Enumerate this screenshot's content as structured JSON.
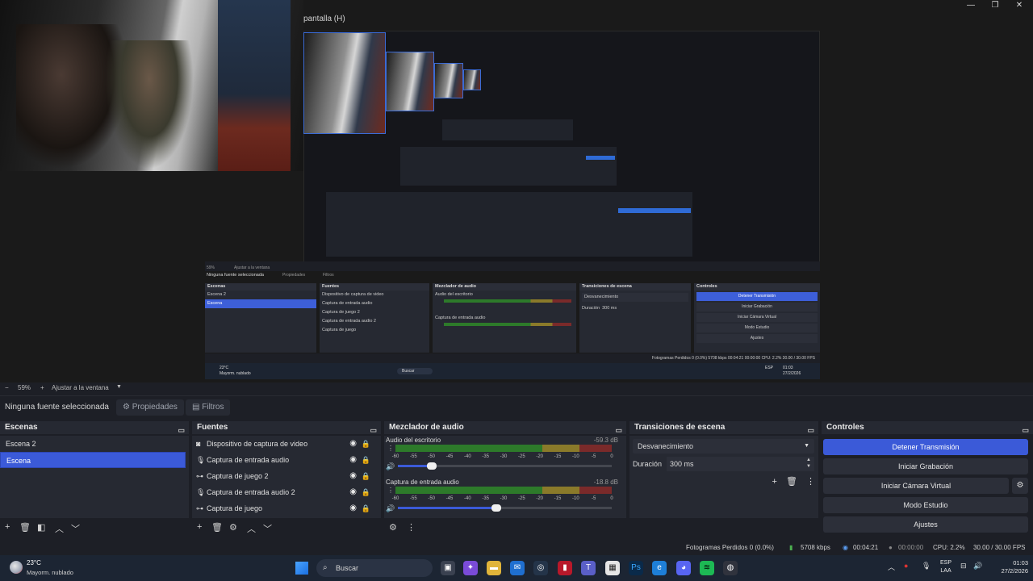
{
  "window": {
    "title": "pantalla (H)",
    "controls": [
      "—",
      "❐",
      "✕"
    ]
  },
  "preview": {
    "nested_obs": {
      "selection": "Ninguna fuente seleccionada",
      "props": "Propiedades",
      "filters": "Filtros",
      "scenes_title": "Escenas",
      "scenes": [
        "Escena 2",
        "Escena"
      ],
      "sources_title": "Fuentes",
      "sources": [
        "Dispositivo de captura de video",
        "Captura de entrada audio",
        "Captura de juego 2",
        "Captura de entrada audio 2",
        "Captura de juego"
      ],
      "mixer_title": "Mezclador de audio",
      "mixer_ch1": "Audio del escritorio",
      "mixer_ch2": "Captura de entrada audio",
      "trans_title": "Transiciones de escena",
      "trans_value": "Desvanecimiento",
      "trans_dur_label": "Duración",
      "trans_dur_value": "300 ms",
      "controls_title": "Controles",
      "controls": [
        "Detener Transmisión",
        "Iniciar Grabación",
        "Iniciar Cámara Virtual",
        "Modo Estudio",
        "Ajustes"
      ],
      "status": "Fotogramas Perdidos 0 (0.0%)   5708 kbps   00:04:21   00:00:00   CPU: 2.2%   30.00 / 30.00 FPS",
      "zoom": "59%",
      "fit": "Ajustar a la ventana",
      "weather": "23°C",
      "weather_cond": "Mayorm. nublado",
      "search": "Buscar",
      "lang": "ESP",
      "date": "27/2/2026",
      "time": "01:03"
    }
  },
  "zoom": {
    "minus": "−",
    "value": "59%",
    "plus": "+",
    "fit_label": "Ajustar a la ventana"
  },
  "context": {
    "selection": "Ninguna fuente seleccionada",
    "properties": "Propiedades",
    "filters": "Filtros"
  },
  "scenes": {
    "title": "Escenas",
    "items": [
      "Escena 2",
      "Escena"
    ],
    "selected": 1
  },
  "sources": {
    "title": "Fuentes",
    "items": [
      {
        "label": "Dispositivo de captura de video",
        "icon": "camera-icon"
      },
      {
        "label": "Captura de entrada audio",
        "icon": "mic-icon"
      },
      {
        "label": "Captura de juego 2",
        "icon": "gamepad-icon"
      },
      {
        "label": "Captura de entrada audio 2",
        "icon": "mic-icon"
      },
      {
        "label": "Captura de juego",
        "icon": "gamepad-icon"
      }
    ]
  },
  "mixer": {
    "title": "Mezclador de audio",
    "ticks": [
      "-60",
      "-55",
      "-50",
      "-45",
      "-40",
      "-35",
      "-30",
      "-25",
      "-20",
      "-15",
      "-10",
      "-5",
      "0"
    ],
    "channels": [
      {
        "name": "Audio del escritorio",
        "db": "-59.3 dB",
        "volume_pct": 16
      },
      {
        "name": "Captura de entrada audio",
        "db": "-18.8 dB",
        "volume_pct": 46
      }
    ]
  },
  "transitions": {
    "title": "Transiciones de escena",
    "selected": "Desvanecimiento",
    "duration_label": "Duración",
    "duration_value": "300 ms"
  },
  "controls": {
    "title": "Controles",
    "stop_stream": "Detener Transmisión",
    "start_recording": "Iniciar Grabación",
    "start_virtual_cam": "Iniciar Cámara Virtual",
    "studio_mode": "Modo Estudio",
    "settings": "Ajustes"
  },
  "status": {
    "dropped_frames": "Fotogramas Perdidos 0 (0.0%)",
    "bitrate": "5708 kbps",
    "stream_time": "00:04:21",
    "rec_time": "00:00:00",
    "cpu": "CPU: 2.2%",
    "fps": "30.00 / 30.00 FPS"
  },
  "taskbar": {
    "temperature": "23°C",
    "condition": "Mayorm. nublado",
    "search_placeholder": "Buscar",
    "lang_top": "ESP",
    "lang_bottom": "LAA",
    "time": "01:03",
    "date": "27/2/2026"
  },
  "colors": {
    "accent": "#3b5ad8",
    "panel": "#262932",
    "background": "#1d1f26",
    "meter_green": "#2d7a2a",
    "meter_yellow": "#8a7a2a",
    "meter_red": "#7a2a2a"
  }
}
